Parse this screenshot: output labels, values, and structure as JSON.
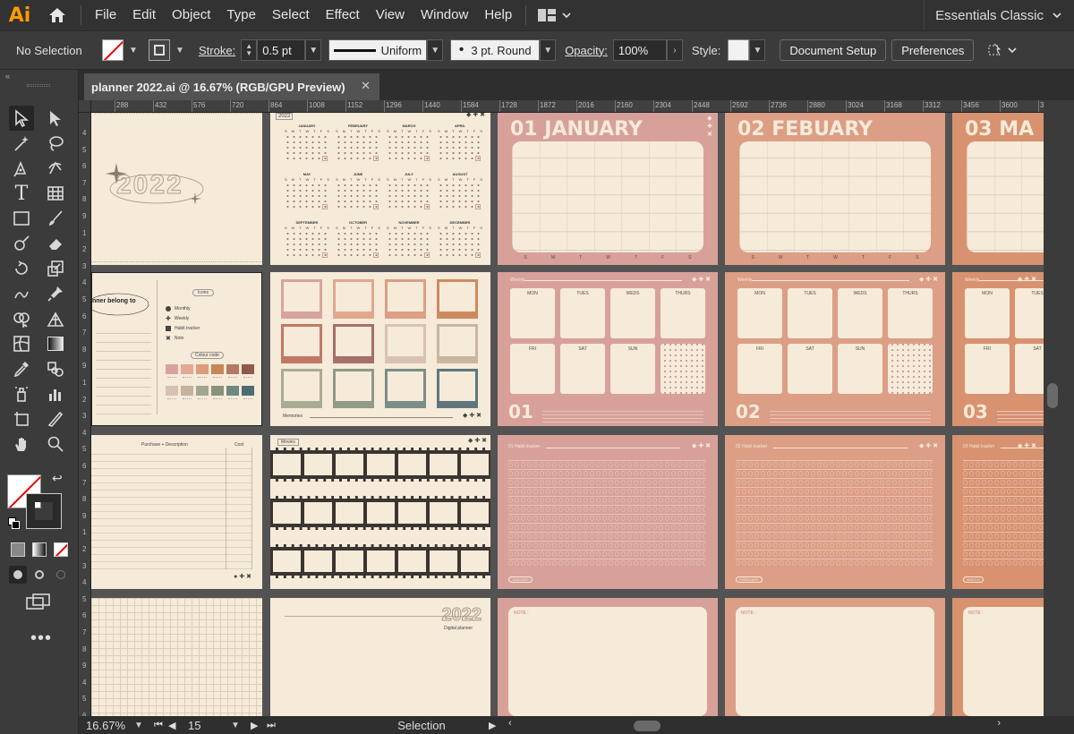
{
  "app": {
    "logo": "Ai",
    "home_icon": "home-icon"
  },
  "menu": [
    "File",
    "Edit",
    "Object",
    "Type",
    "Select",
    "Effect",
    "View",
    "Window",
    "Help"
  ],
  "workspace": "Essentials Classic",
  "control": {
    "selection": "No Selection",
    "stroke_label": "Stroke:",
    "stroke_weight": "0.5 pt",
    "profile": "Uniform",
    "brush": "3 pt. Round",
    "opacity_label": "Opacity:",
    "opacity": "100%",
    "style_label": "Style:",
    "document_setup": "Document Setup",
    "preferences": "Preferences"
  },
  "doc": {
    "tab_title": "planner 2022.ai @ 16.67% (RGB/GPU Preview)",
    "close": "✕"
  },
  "ruler_h": [
    "288",
    "432",
    "576",
    "720",
    "864",
    "1008",
    "1152",
    "1296",
    "1440",
    "1584",
    "1728",
    "1872",
    "2016",
    "2160",
    "2304",
    "2448",
    "2592",
    "2736",
    "2880",
    "3024",
    "3168",
    "3312",
    "3456",
    "3600",
    "3744"
  ],
  "ruler_v": [
    "4",
    "5",
    "6",
    "7",
    "8",
    "9",
    "1",
    "2",
    "3",
    "4",
    "5",
    "6",
    "7",
    "8",
    "9",
    "1",
    "2",
    "3",
    "4",
    "5",
    "6",
    "7",
    "8",
    "9",
    "1",
    "2",
    "3",
    "4",
    "5",
    "6",
    "7",
    "8",
    "9",
    "4",
    "5",
    "6"
  ],
  "status": {
    "zoom": "16.67%",
    "artboard": "15",
    "tool": "Selection"
  },
  "colors": {
    "cream": "#f6ead9",
    "pink": "#d7a19a",
    "salmon": "#dc9e85",
    "orange": "#d89270"
  },
  "artboards": {
    "cover_year": "2022",
    "calendar_year": "2022",
    "months_small": [
      "JANUARY",
      "FEBRUARY",
      "MARCH",
      "APRIL",
      "MAY",
      "JUNE",
      "JULY",
      "AUGUST",
      "SEPTEMBER",
      "OCTOBER",
      "NOVEMBER",
      "DECEMBER"
    ],
    "month_titles": [
      "01 JANUARY",
      "02 FEBUARY",
      "03 MA"
    ],
    "weekday_letters": [
      "S",
      "M",
      "T",
      "W",
      "T",
      "F",
      "S"
    ],
    "belong_title": "nner belong to",
    "icons_title": "Icons",
    "icon_labels": [
      "Monthly",
      "Weekly",
      "Habit tracker",
      "Note"
    ],
    "colour_title": "Colour code",
    "memories": "Memories",
    "weekly_label": "Weekly",
    "weekly_days": [
      "MON",
      "TUES",
      "WEDS",
      "THURS",
      "FRI",
      "SAT",
      "SUN"
    ],
    "weekly_nums": [
      "01",
      "02",
      "03"
    ],
    "habit_labels": [
      "01  Habit tracker",
      "02  Habit tracker",
      "03  Habit tracker"
    ],
    "habit_months": [
      "JANUARY",
      "FEBRUARY",
      "MARCH"
    ],
    "purchase_header": "Purchase + Description",
    "cost_header": "Cost",
    "movies": "Movies",
    "digital_year": "2022",
    "digital_label": "Digital planner",
    "note_label": "NOTE :"
  }
}
